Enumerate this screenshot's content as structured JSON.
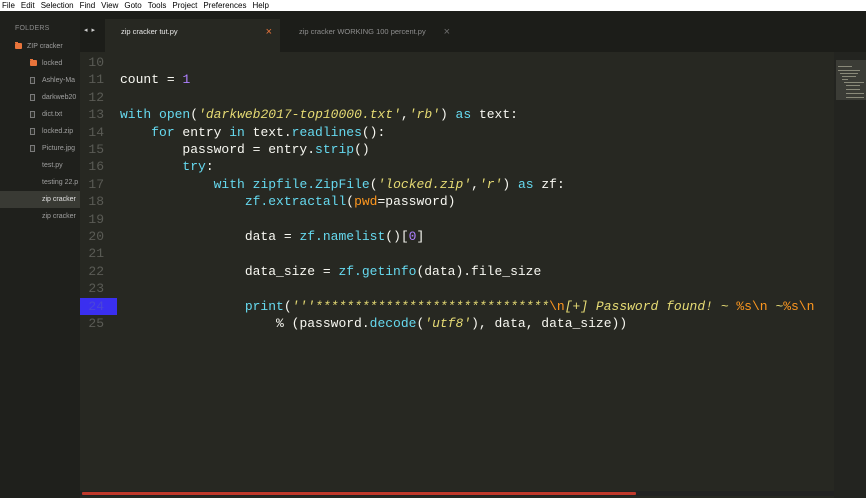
{
  "menu": [
    "File",
    "Edit",
    "Selection",
    "Find",
    "View",
    "Goto",
    "Tools",
    "Project",
    "Preferences",
    "Help"
  ],
  "sidebar": {
    "heading": "FOLDERS",
    "items": [
      {
        "label": "ZIP cracker",
        "type": "folder"
      },
      {
        "label": "locked",
        "type": "folder"
      },
      {
        "label": "Ashley-Ma",
        "type": "file"
      },
      {
        "label": "darkweb20",
        "type": "file"
      },
      {
        "label": "dict.txt",
        "type": "file"
      },
      {
        "label": "locked.zip",
        "type": "file"
      },
      {
        "label": "Picture.jpg",
        "type": "file"
      },
      {
        "label": "test.py",
        "type": "file"
      },
      {
        "label": "testing 22.p",
        "type": "file"
      },
      {
        "label": "zip cracker",
        "type": "file",
        "active": true
      },
      {
        "label": "zip cracker",
        "type": "file"
      }
    ]
  },
  "tabs": {
    "nav": "◂ ▸",
    "items": [
      {
        "label": "zip cracker tut.py",
        "close": "×",
        "active": true
      },
      {
        "label": "zip cracker WORKING 100 percent.py",
        "close": "×",
        "active": false
      }
    ]
  },
  "editor": {
    "line_numbers": [
      "10",
      "11",
      "12",
      "13",
      "14",
      "15",
      "16",
      "17",
      "18",
      "19",
      "20",
      "21",
      "22",
      "23",
      "24",
      "25"
    ],
    "highlighted_line": "24",
    "lines": [
      [],
      [
        {
          "t": "count ",
          "c": ""
        },
        {
          "t": "=",
          "c": ""
        },
        {
          "t": " ",
          "c": ""
        },
        {
          "t": "1",
          "c": "num"
        }
      ],
      [],
      [
        {
          "t": "with",
          "c": "kw"
        },
        {
          "t": " ",
          "c": ""
        },
        {
          "t": "open",
          "c": "kw"
        },
        {
          "t": "(",
          "c": ""
        },
        {
          "t": "'darkweb2017-top10000.txt'",
          "c": "str"
        },
        {
          "t": ",",
          "c": ""
        },
        {
          "t": "'rb'",
          "c": "str"
        },
        {
          "t": ") ",
          "c": ""
        },
        {
          "t": "as",
          "c": "kw"
        },
        {
          "t": " text:",
          "c": ""
        }
      ],
      [
        {
          "t": "    ",
          "c": ""
        },
        {
          "t": "for",
          "c": "kw"
        },
        {
          "t": " entry ",
          "c": ""
        },
        {
          "t": "in",
          "c": "kw"
        },
        {
          "t": " text.",
          "c": ""
        },
        {
          "t": "readlines",
          "c": "kw"
        },
        {
          "t": "():",
          "c": ""
        }
      ],
      [
        {
          "t": "        password = entry.",
          "c": ""
        },
        {
          "t": "strip",
          "c": "kw"
        },
        {
          "t": "()",
          "c": ""
        }
      ],
      [
        {
          "t": "        ",
          "c": ""
        },
        {
          "t": "try",
          "c": "kw"
        },
        {
          "t": ":",
          "c": ""
        }
      ],
      [
        {
          "t": "            ",
          "c": ""
        },
        {
          "t": "with",
          "c": "kw"
        },
        {
          "t": " ",
          "c": ""
        },
        {
          "t": "zipfile.ZipFile",
          "c": "kw"
        },
        {
          "t": "(",
          "c": ""
        },
        {
          "t": "'locked.zip'",
          "c": "str"
        },
        {
          "t": ",",
          "c": ""
        },
        {
          "t": "'r'",
          "c": "str"
        },
        {
          "t": ") ",
          "c": ""
        },
        {
          "t": "as",
          "c": "kw"
        },
        {
          "t": " zf:",
          "c": ""
        }
      ],
      [
        {
          "t": "                ",
          "c": ""
        },
        {
          "t": "zf.extractall",
          "c": "kw"
        },
        {
          "t": "(",
          "c": ""
        },
        {
          "t": "pwd",
          "c": "esc"
        },
        {
          "t": "=password)",
          "c": ""
        }
      ],
      [],
      [
        {
          "t": "                data = ",
          "c": ""
        },
        {
          "t": "zf.namelist",
          "c": "kw"
        },
        {
          "t": "()[",
          "c": ""
        },
        {
          "t": "0",
          "c": "num"
        },
        {
          "t": "]",
          "c": ""
        }
      ],
      [],
      [
        {
          "t": "                data_size = ",
          "c": ""
        },
        {
          "t": "zf.getinfo",
          "c": "kw"
        },
        {
          "t": "(data).file_size",
          "c": ""
        }
      ],
      [],
      [
        {
          "t": "                ",
          "c": ""
        },
        {
          "t": "print",
          "c": "kw"
        },
        {
          "t": "(",
          "c": ""
        },
        {
          "t": "'''******************************",
          "c": "str"
        },
        {
          "t": "\\n",
          "c": "esc"
        },
        {
          "t": "[+] Password found! ~ ",
          "c": "str"
        },
        {
          "t": "%s",
          "c": "esc"
        },
        {
          "t": "\\n",
          "c": "esc"
        },
        {
          "t": " ~",
          "c": "str"
        },
        {
          "t": "%s",
          "c": "esc"
        },
        {
          "t": "\\n",
          "c": "esc"
        }
      ],
      [
        {
          "t": "                    ",
          "c": ""
        },
        {
          "t": "% ",
          "c": ""
        },
        {
          "t": "(password.",
          "c": ""
        },
        {
          "t": "decode",
          "c": "kw"
        },
        {
          "t": "(",
          "c": ""
        },
        {
          "t": "'utf8'",
          "c": "str"
        },
        {
          "t": "), data, data_size))",
          "c": ""
        }
      ]
    ]
  },
  "colors": {
    "editor_bg": "#272822",
    "sidebar_bg": "#1f201c",
    "accent": "#e8743b",
    "line_highlight": "#3a2ff0"
  }
}
